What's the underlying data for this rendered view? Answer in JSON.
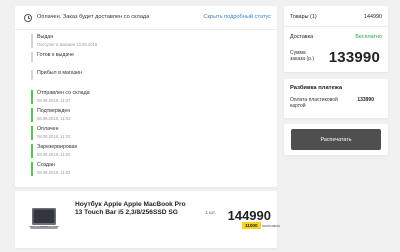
{
  "status": {
    "title": "Оплачен. Заказ будет доставлен со склада",
    "link": "Скрыть подробный статус"
  },
  "timeline": [
    {
      "title": "Выдан",
      "date": "Поступит в магазин 13.08.2018",
      "done": false,
      "muted": false
    },
    {
      "title": "Готов к выдаче",
      "date": "",
      "done": false,
      "muted": false
    },
    {
      "title": "Прибыл в магазин",
      "date": "",
      "done": false,
      "muted": false
    },
    {
      "title": "Отправлен со склада",
      "date": "08.08.2018, 11:37",
      "done": true,
      "muted": false
    },
    {
      "title": "Подтвержден",
      "date": "08.08.2018, 11:02",
      "done": true,
      "muted": false
    },
    {
      "title": "Оплачен",
      "date": "08.08.2018, 11:02",
      "done": true,
      "muted": false
    },
    {
      "title": "Зарезервирован",
      "date": "08.08.2018, 11:02",
      "done": true,
      "muted": false
    },
    {
      "title": "Создан",
      "date": "08.08.2018, 11:02",
      "done": true,
      "muted": false
    }
  ],
  "summary": {
    "items_label": "Товары (1)",
    "items_value": "144990",
    "delivery_label": "Доставка",
    "delivery_value": "Бесплатно",
    "total_label": "Сумма заказа (р.)",
    "total_value": "133990"
  },
  "payment": {
    "title": "Разбивка платежа",
    "method_label": "Оплата пластиковой картой",
    "method_value": "133990"
  },
  "pay_button": {
    "label": "Распечатать"
  },
  "product": {
    "name": "Ноутбук Apple Apple MacBook Pro 13 Touch Bar i5 2,3/8/256SSD SG",
    "qty": "1 шт.",
    "price": "144990",
    "bonus_value": "11000",
    "bonus_label": "экономия",
    "icon": "laptop-icon"
  },
  "colors": {
    "accent_link": "#3b82c4",
    "timeline_done": "#5cbf5c",
    "free_delivery": "#2aa24a",
    "bonus_badge": "#f7d41f",
    "button_bg": "#4f4f4f"
  }
}
